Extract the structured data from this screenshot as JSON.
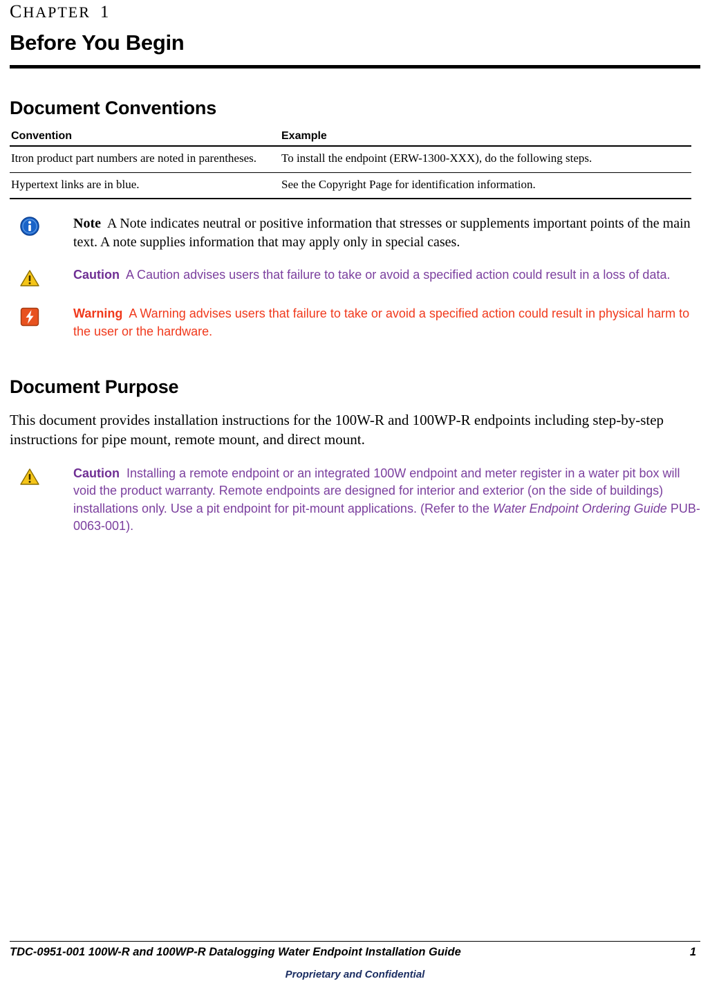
{
  "chapter": {
    "label": "CHAPTER",
    "label_first": "C",
    "label_rest": "HAPTER",
    "number": "1",
    "title": "Before You Begin"
  },
  "sections": {
    "conventions": {
      "heading": "Document Conventions",
      "table": {
        "headers": [
          "Convention",
          "Example"
        ],
        "rows": [
          [
            "Itron product part numbers are noted in parentheses.",
            "To install the endpoint (ERW-1300-XXX), do the following steps."
          ],
          [
            "Hypertext links are in blue.",
            "See the Copyright Page for identification information."
          ]
        ]
      }
    },
    "purpose": {
      "heading": "Document Purpose",
      "paragraph": "This document provides installation instructions for the 100W-R and 100WP-R endpoints including step-by-step instructions for pipe mount, remote mount, and direct mount."
    }
  },
  "admonitions": [
    {
      "icon": "note-info-icon",
      "type": "note",
      "lead": "Note",
      "text": "A Note indicates neutral or positive information that stresses or supplements important points of the main text. A note supplies information that may apply only in special cases.",
      "color": "#000000"
    },
    {
      "icon": "caution-triangle-icon",
      "type": "caution",
      "lead": "Caution",
      "text": "A Caution advises users that failure to take or avoid a specified action could result in a loss of data.",
      "color": "#7b3f9e"
    },
    {
      "icon": "warning-bolt-icon",
      "type": "warning",
      "lead": "Warning",
      "text": "A Warning advises users that failure to take or avoid a specified action could result in physical harm to the user or the hardware.",
      "color": "#f0391c"
    }
  ],
  "purpose_caution": {
    "icon": "caution-triangle-icon",
    "lead": "Caution",
    "text_before": "Installing a remote endpoint or an integrated 100W endpoint and meter register in a water pit box will void the product warranty. Remote endpoints are designed for interior and exterior (on the side of buildings) installations only. Use a pit endpoint for pit-mount applications. (Refer to the ",
    "italic_ref": "Water Endpoint Ordering Guide",
    "text_after": " PUB-0063-001).",
    "color": "#7b3f9e"
  },
  "footer": {
    "left": "TDC-0951-001 100W-R and 100WP-R Datalogging Water Endpoint Installation Guide",
    "page_number": "1",
    "confidential": "Proprietary and Confidential"
  }
}
